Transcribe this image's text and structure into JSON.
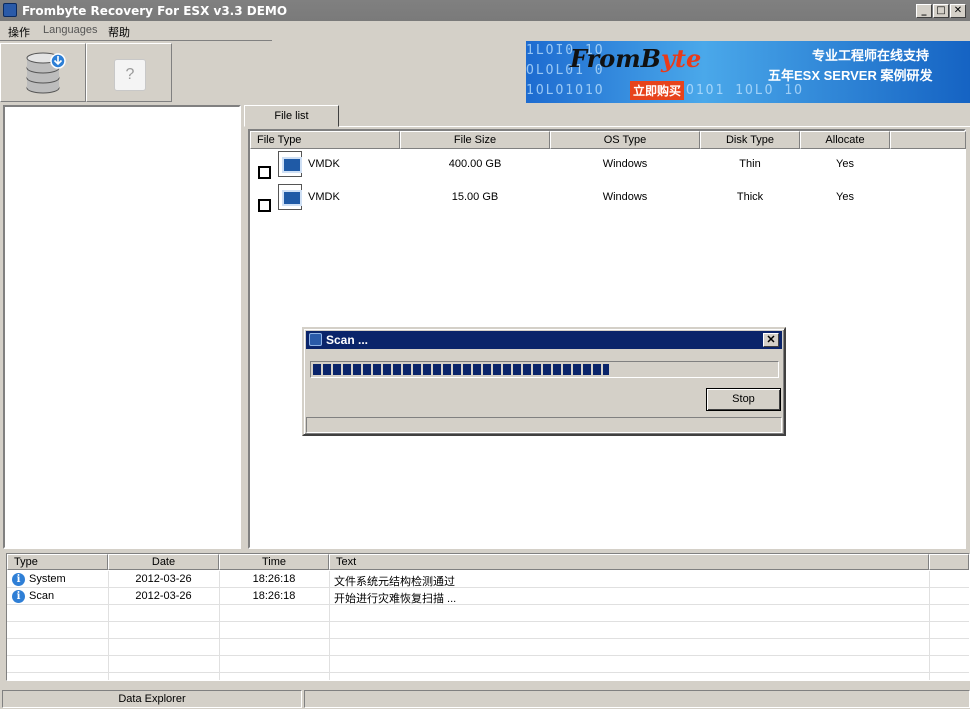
{
  "window": {
    "title": "Frombyte Recovery For ESX v3.3 DEMO",
    "buttons": [
      "_",
      "□",
      "✕"
    ]
  },
  "menu": {
    "items": [
      "操作",
      "Languages",
      "帮助"
    ]
  },
  "toolbar": {
    "help_glyph": "?"
  },
  "banner": {
    "logo_left": "FromB",
    "logo_right": "yte",
    "buy": "立即购买",
    "line1": "专业工程师在线支持",
    "line2": "五年ESX SERVER 案例研发"
  },
  "tabs": [
    "File list"
  ],
  "file_list": {
    "columns": [
      "File Type",
      "File Size",
      "OS Type",
      "Disk Type",
      "Allocate"
    ],
    "rows": [
      {
        "type": "VMDK",
        "size": "400.00 GB",
        "os": "Windows",
        "disk": "Thin",
        "allocate": "Yes"
      },
      {
        "type": "VMDK",
        "size": "15.00 GB",
        "os": "Windows",
        "disk": "Thick",
        "allocate": "Yes"
      }
    ]
  },
  "dialog": {
    "title": "Scan ...",
    "close": "✕",
    "progress_percent": 64,
    "stop_label": "Stop"
  },
  "log": {
    "columns": [
      "Type",
      "Date",
      "Time",
      "Text"
    ],
    "rows": [
      {
        "type": "System",
        "date": "2012-03-26",
        "time": "18:26:18",
        "text": "文件系统元结构检测通过"
      },
      {
        "type": "Scan",
        "date": "2012-03-26",
        "time": "18:26:18",
        "text": "开始进行灾难恢复扫描 ..."
      }
    ]
  },
  "statusbar": {
    "panel1": "Data Explorer"
  },
  "colors": {
    "title_bar": "#808080",
    "dialog_title": "#0a246a",
    "progress": "#0a246a",
    "banner": "#1d6bd0"
  }
}
